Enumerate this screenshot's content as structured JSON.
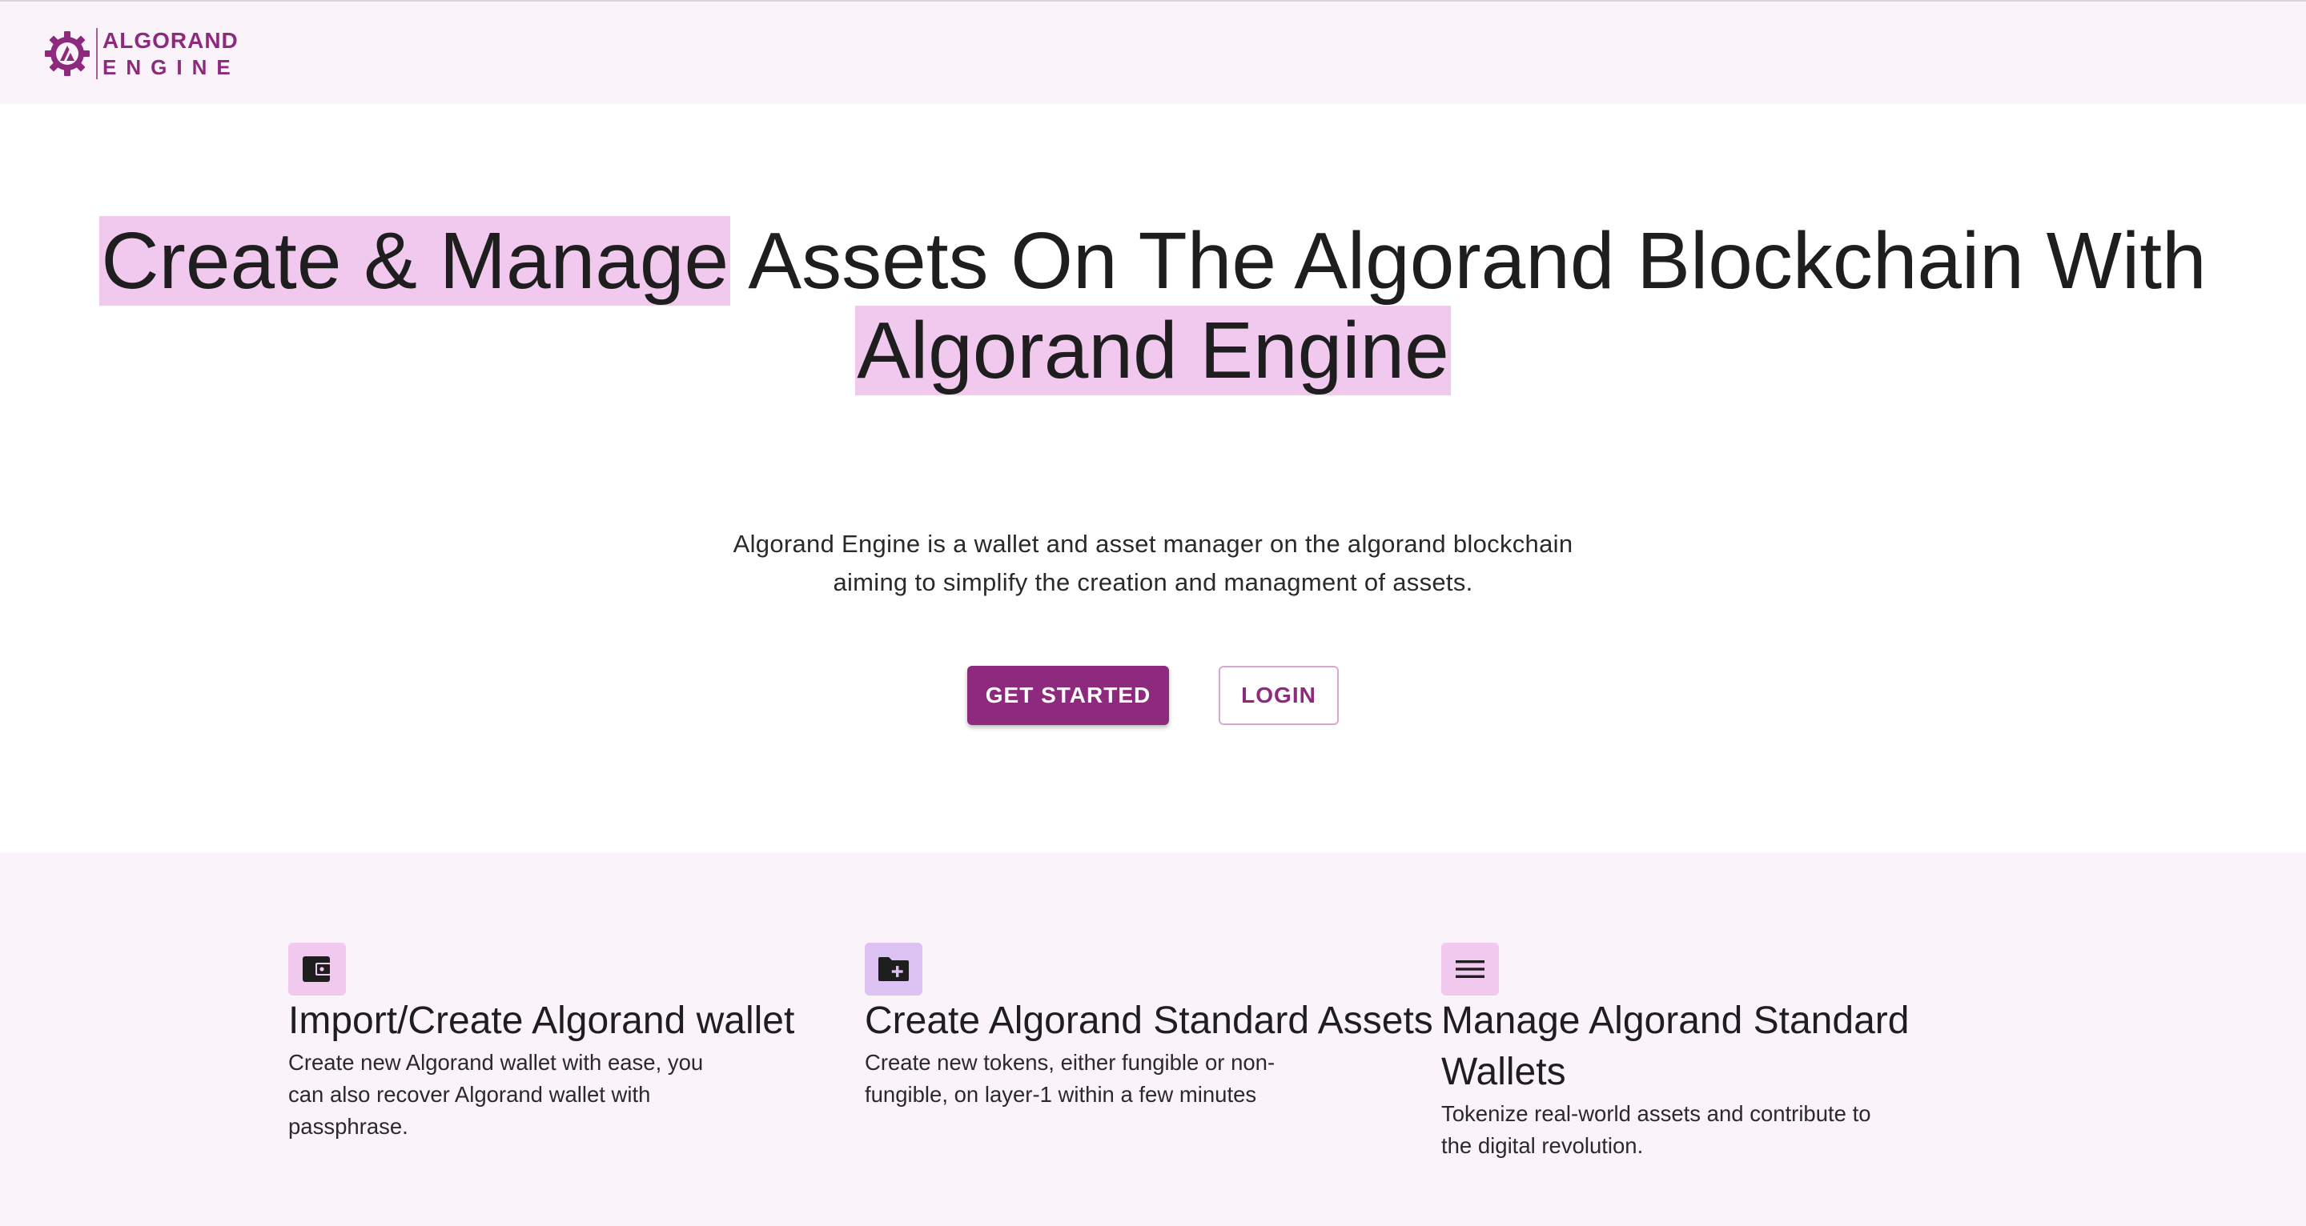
{
  "brand": {
    "line1": "ALGORAND",
    "line2": "ENGINE",
    "color": "#8e2a7e"
  },
  "hero": {
    "title_highlight_1": "Create & Manage",
    "title_plain_1": " Assets On The Algorand Blockchain With ",
    "title_highlight_2": "Algorand Engine",
    "subtitle": "Algorand Engine is a wallet and asset manager on the algorand blockchain aiming to simplify the creation and managment of assets.",
    "get_started_label": "GET STARTED",
    "login_label": "LOGIN",
    "highlight_color": "#f2c9ee"
  },
  "features": [
    {
      "icon": "wallet-icon",
      "title": "Import/Create Algorand wallet",
      "description": "Create new Algorand wallet with ease, you can also recover Algorand wallet with passphrase."
    },
    {
      "icon": "folder-plus-icon",
      "title": "Create Algorand Standard Assets",
      "description": "Create new tokens, either fungible or non-fungible, on layer-1 within a few minutes"
    },
    {
      "icon": "menu-lines-icon",
      "title": "Manage Algorand Standard Wallets",
      "description": "Tokenize real-world assets and contribute to the digital revolution."
    }
  ]
}
